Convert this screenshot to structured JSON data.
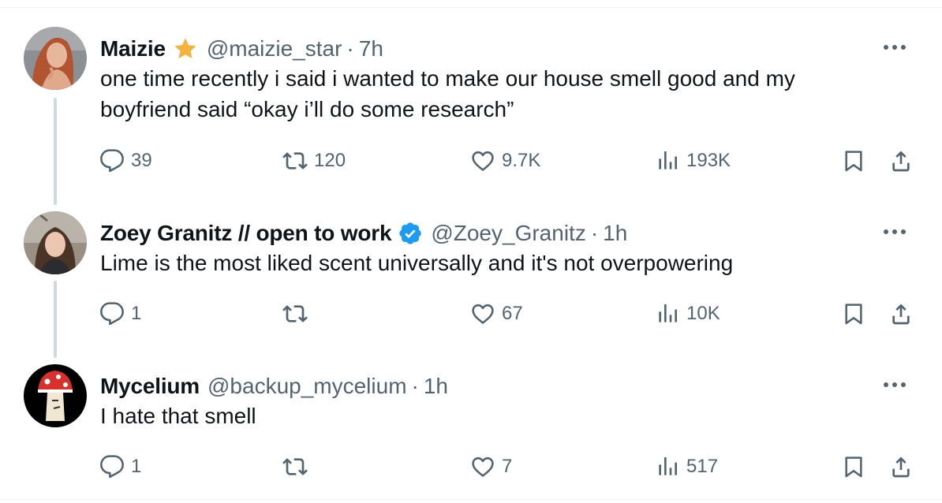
{
  "tweets": [
    {
      "name": "Maizie",
      "handle": "@maizie_star",
      "time": "7h",
      "badge": "gold-star",
      "text_lines": [
        "one time recently i said i wanted to make our house smell good and my",
        "boyfriend said “okay i’ll do some research”"
      ],
      "replies": "39",
      "retweets": "120",
      "likes": "9.7K",
      "views": "193K"
    },
    {
      "name": "Zoey Granitz // open to work",
      "handle": "@Zoey_Granitz",
      "time": "1h",
      "badge": "verified-blue",
      "text_lines": [
        "Lime is the most liked scent universally and it's not overpowering"
      ],
      "replies": "1",
      "retweets": "",
      "likes": "67",
      "views": "10K"
    },
    {
      "name": "Mycelium",
      "handle": "@backup_mycelium",
      "time": "1h",
      "badge": "",
      "text_lines": [
        "I hate that smell"
      ],
      "replies": "1",
      "retweets": "",
      "likes": "7",
      "views": "517"
    }
  ],
  "separator": "·",
  "colors": {
    "verified": "#1d9bf0",
    "star": "#f4b33e",
    "muted": "#536471",
    "thread_line": "#cfd9de"
  },
  "icons": [
    "reply-icon",
    "retweet-icon",
    "like-icon",
    "views-icon",
    "bookmark-icon",
    "share-icon",
    "more-icon"
  ]
}
